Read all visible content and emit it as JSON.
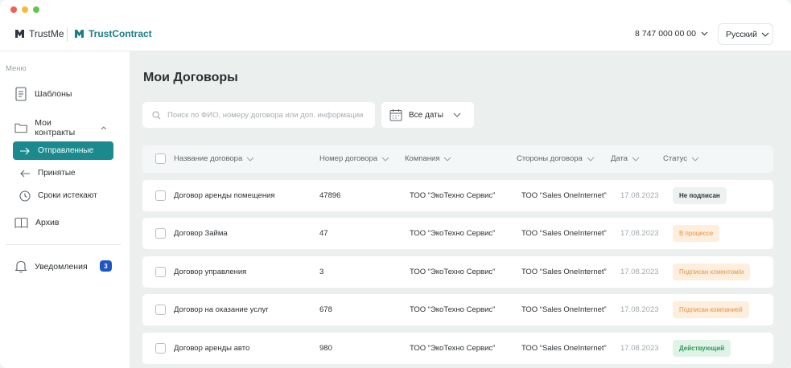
{
  "header": {
    "brand_left": "TrustMe",
    "brand_right": "TrustContract",
    "phone": "8 747 000 00 00",
    "language": "Русский"
  },
  "sidebar": {
    "caption": "Меню",
    "items": {
      "templates": "Шаблоны",
      "my_contracts": "Мои контракты",
      "sent": "Отправленные",
      "received": "Принятые",
      "expiring": "Сроки истекают",
      "archive": "Архив",
      "notifications": "Уведомления"
    },
    "notifications_count": "3"
  },
  "main": {
    "title": "Мои Договоры",
    "search_placeholder": "Поиск по ФИО, номеру договора или доп. информации",
    "dates_filter": "Все даты",
    "columns": {
      "name": "Название договора",
      "number": "Номер договора",
      "company": "Компания",
      "parties": "Стороны договора",
      "date": "Дата",
      "status": "Статус"
    },
    "rows": [
      {
        "name": "Договор аренды помещения",
        "number": "47896",
        "company": "ТОО “ЭкоТехно Сервис”",
        "parties": "ТОО “Sales OneInternet”",
        "date": "17.08.2023",
        "status": "Не подписан"
      },
      {
        "name": "Договор Займа",
        "number": "47",
        "company": "ТОО “ЭкоТехно Сервис”",
        "parties": "ТОО “Sales OneInternet”",
        "date": "17.08.2023",
        "status": "В процессе"
      },
      {
        "name": "Договор управления",
        "number": "3",
        "company": "ТОО “ЭкоТехно Сервис”",
        "parties": "ТОО “Sales OneInternet”",
        "date": "17.08.2023",
        "status": "Подписан клиентом/и"
      },
      {
        "name": "Договор на оказание услуг",
        "number": "678",
        "company": "ТОО “ЭкоТехно Сервис”",
        "parties": "ТОО “Sales OneInternet”",
        "date": "17.08.2023",
        "status": "Подписан компанией"
      },
      {
        "name": "Договор аренды авто",
        "number": "980",
        "company": "ТОО “ЭкоТехно Сервис”",
        "parties": "ТОО “Sales OneInternet”",
        "date": "17.08.2023",
        "status": "Действующий"
      }
    ]
  },
  "colors": {
    "accent": "#1a8a8f",
    "badge": "#1d57c4",
    "status_orange": "#e7923d",
    "status_green": "#2f9a5b"
  }
}
